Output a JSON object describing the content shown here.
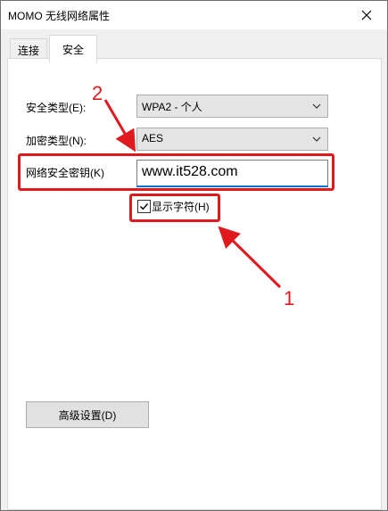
{
  "window": {
    "title": "MOMO 无线网络属性"
  },
  "tabs": [
    {
      "label": "连接"
    },
    {
      "label": "安全"
    }
  ],
  "security": {
    "type_label": "安全类型(E):",
    "type_value": "WPA2 - 个人",
    "encryption_label": "加密类型(N):",
    "encryption_value": "AES",
    "key_label": "网络安全密钥(K)",
    "key_value": "www.it528.com",
    "show_chars_label": "显示字符(H)",
    "show_chars_checked": true,
    "advanced_button": "高级设置(D)"
  },
  "annotations": {
    "num1": "1",
    "num2": "2",
    "color": "#e0191f"
  }
}
